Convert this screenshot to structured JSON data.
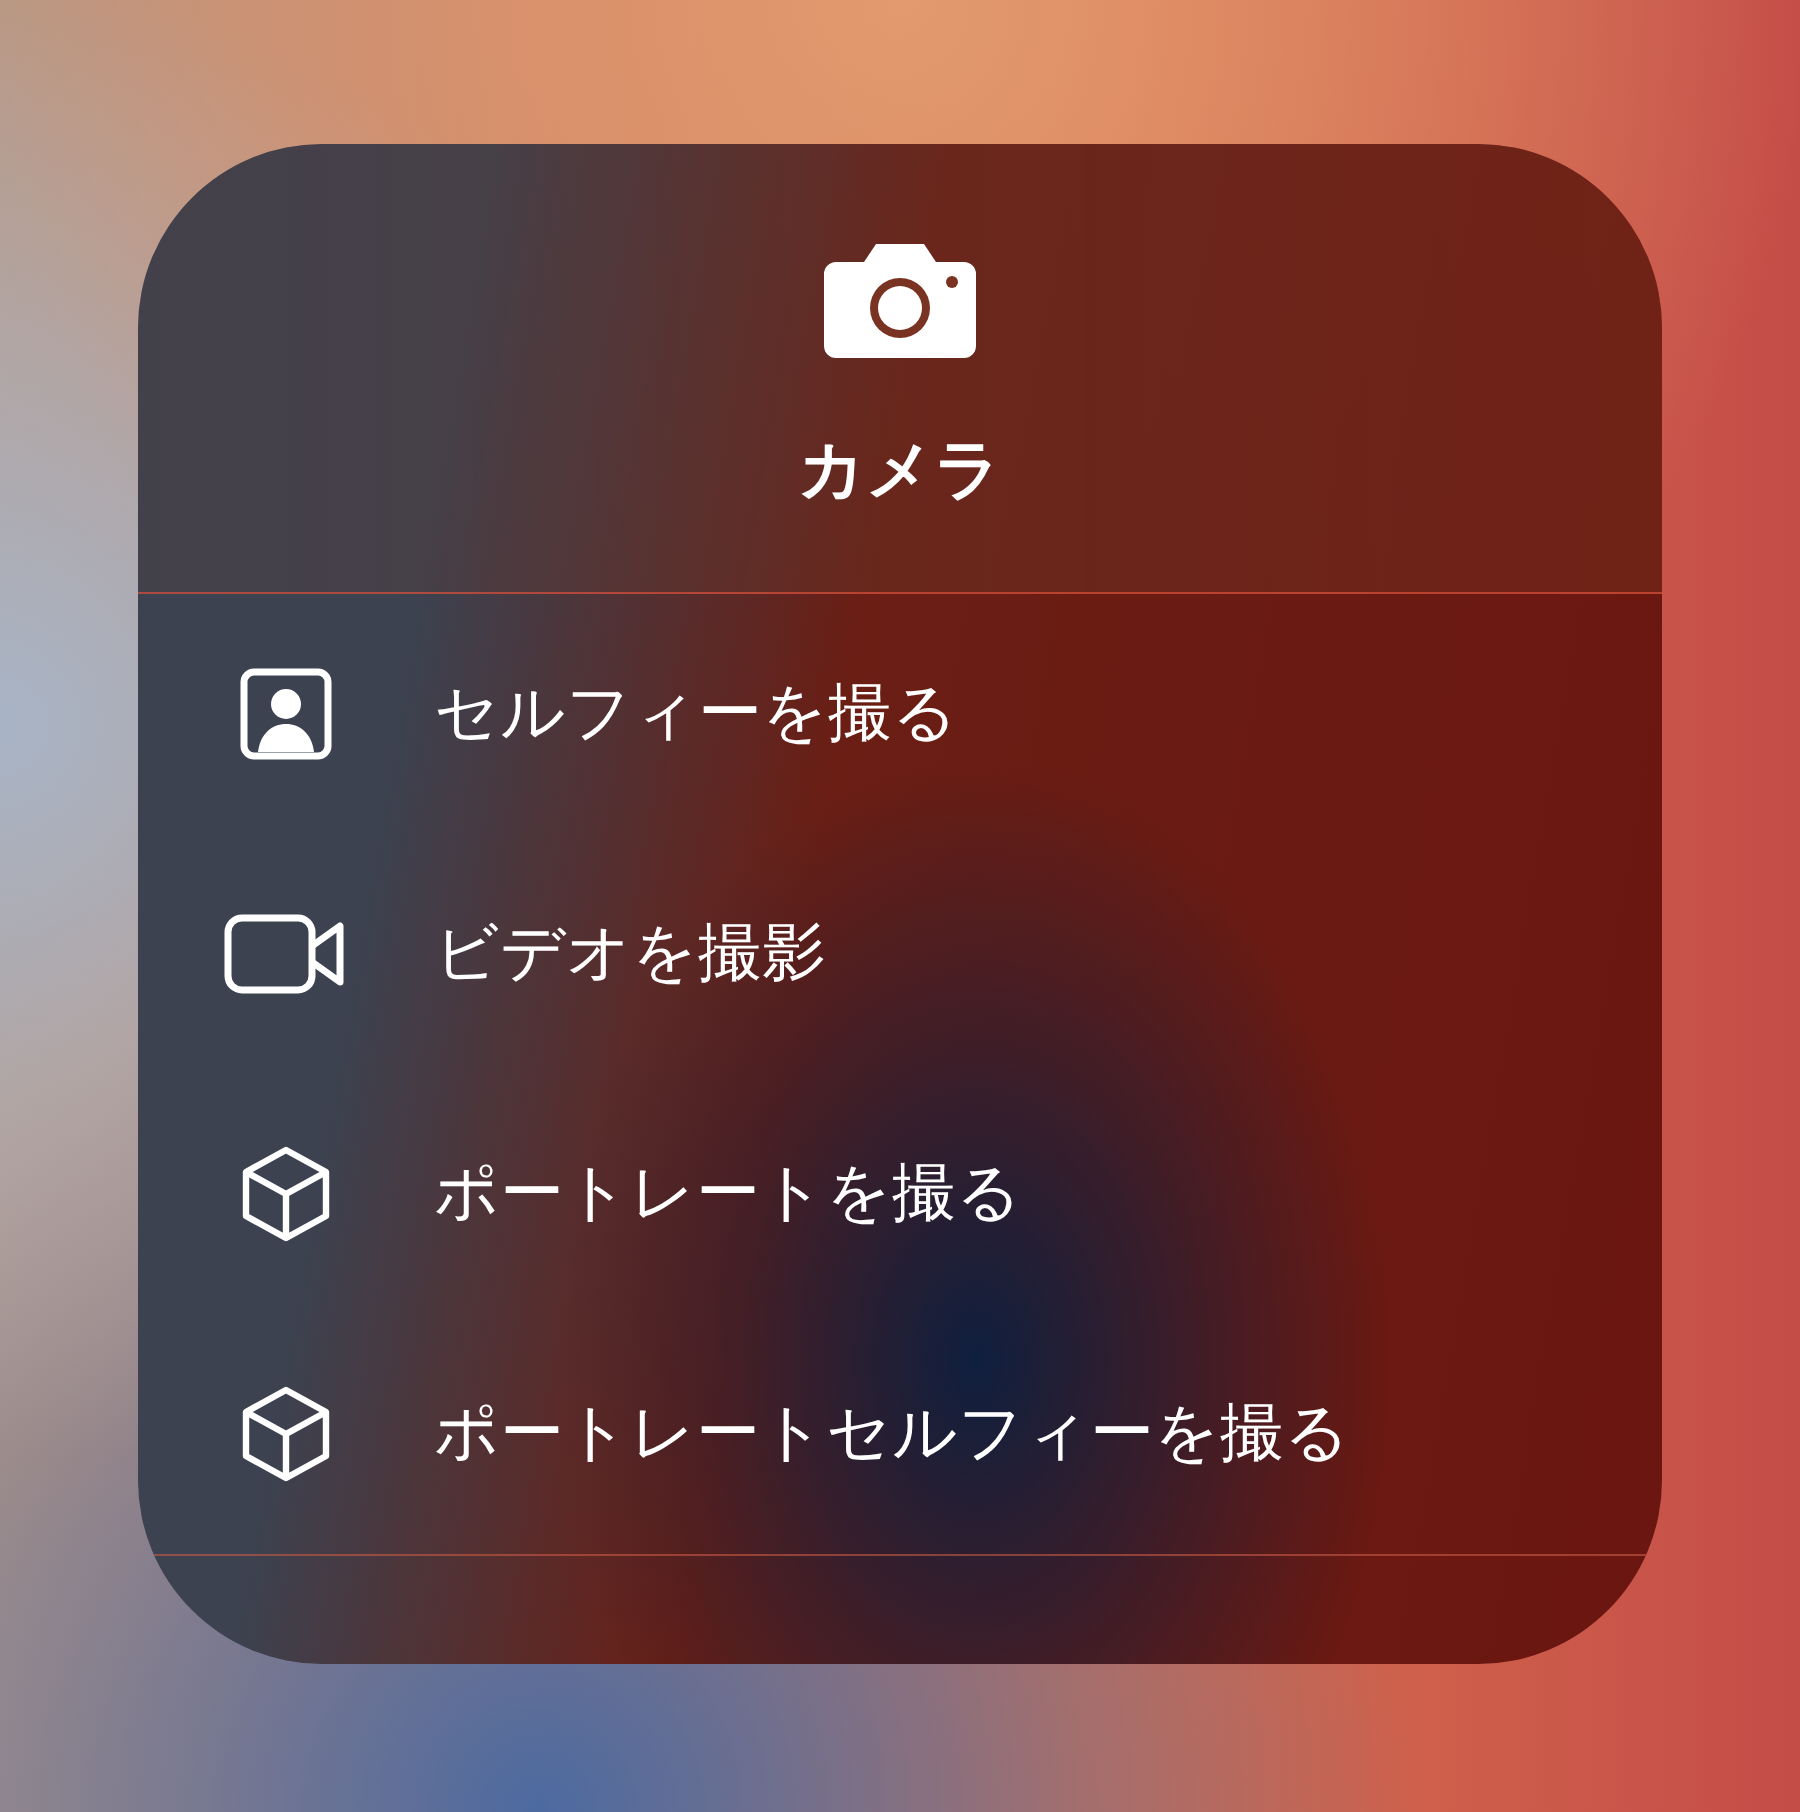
{
  "title": "カメラ",
  "actions": [
    {
      "label": "セルフィーを撮る",
      "kind": "person"
    },
    {
      "label": "ビデオを撮影",
      "kind": "video"
    },
    {
      "label": "ポートレートを撮る",
      "kind": "cube"
    },
    {
      "label": "ポートレートセルフィーを撮る",
      "kind": "cube"
    }
  ]
}
